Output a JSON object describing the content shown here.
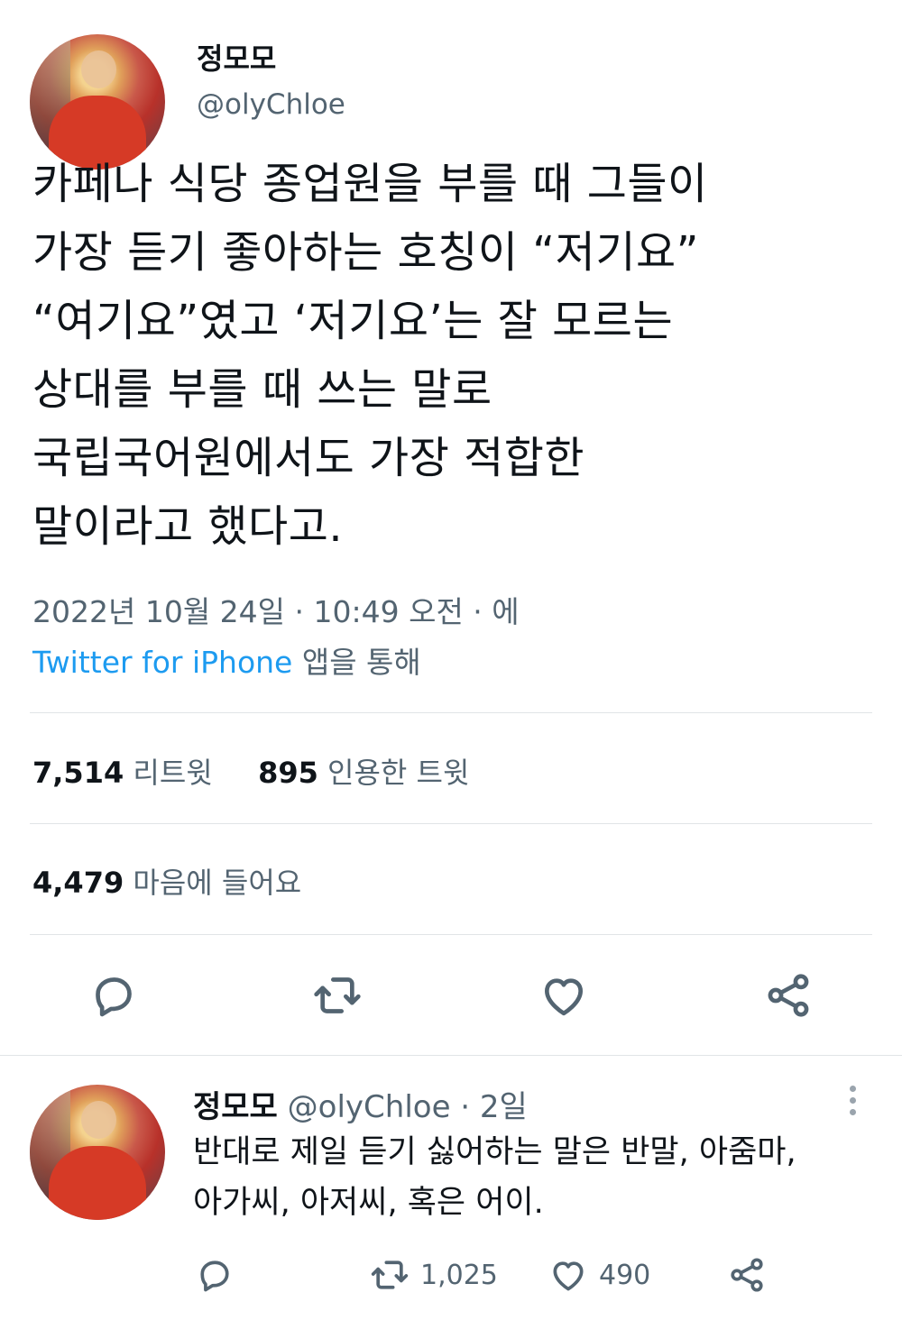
{
  "tweet": {
    "display_name": "정모모",
    "handle": "@olyChloe",
    "text_lines": [
      "카페나 식당 종업원을 부를 때 그들이",
      "가장 듣기 좋아하는 호칭이 “저기요”",
      "“여기요”였고 ‘저기요’는 잘 모르는",
      "상대를 부를 때 쓰는 말로",
      "국립국어원에서도 가장 적합한",
      "말이라고 했다고."
    ],
    "timestamp": "2022년 10월 24일 · 10:49 오전 · 에",
    "source_link": "Twitter for iPhone",
    "source_suffix": " 앱을 통해"
  },
  "stats": {
    "retweets_count": "7,514",
    "retweets_label": " 리트윗",
    "quotes_count": "895",
    "quotes_label": " 인용한 트윗",
    "likes_count": "4,479",
    "likes_label": " 마음에 들어요"
  },
  "actions": {
    "icons": [
      "reply-icon",
      "retweet-icon",
      "like-icon",
      "share-icon"
    ]
  },
  "reply": {
    "display_name": "정모모",
    "handle": "@olyChloe",
    "separator": " · ",
    "time": "2일",
    "text_lines": [
      "반대로 제일 듣기 싫어하는 말은 반말, 아줌마,",
      "아가씨, 아저씨, 혹은 어이."
    ],
    "retweets": "1,025",
    "likes": "490"
  },
  "colors": {
    "text": "#0f1419",
    "secondary": "#536471",
    "link": "#1d9bf0",
    "divider": "#e1e4e7"
  }
}
